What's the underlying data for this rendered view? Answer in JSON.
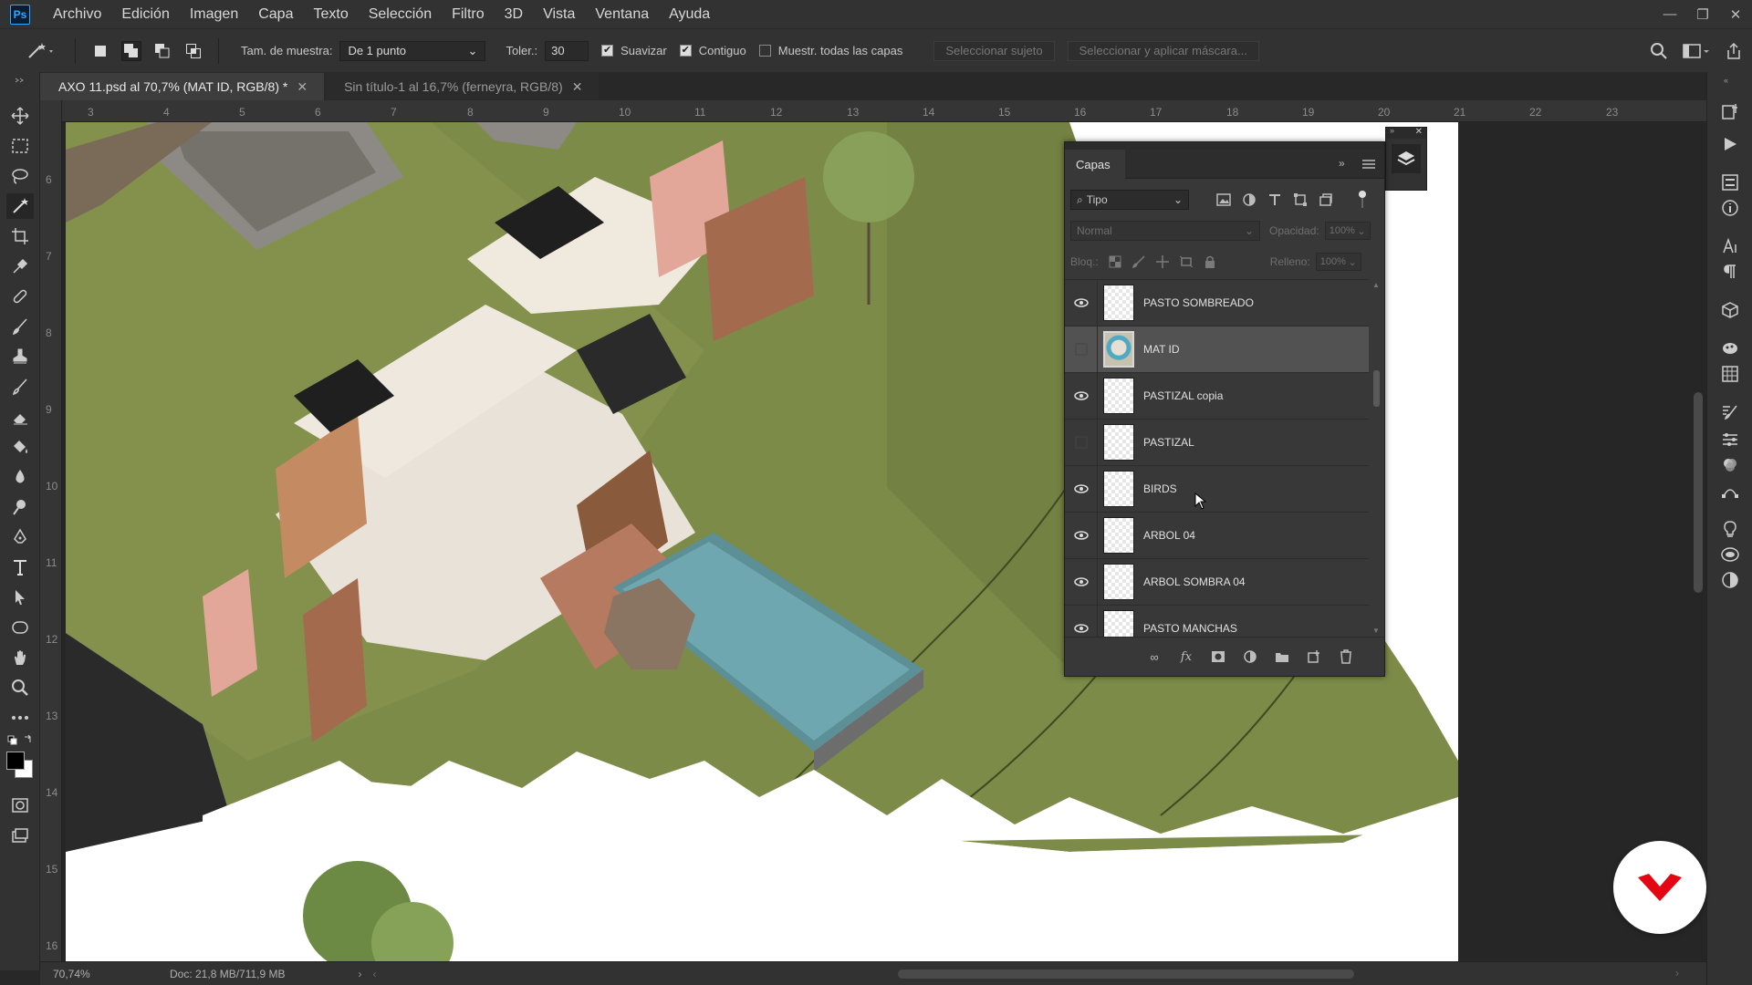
{
  "app": {
    "logo_text": "Ps",
    "menu": [
      "Archivo",
      "Edición",
      "Imagen",
      "Capa",
      "Texto",
      "Selección",
      "Filtro",
      "3D",
      "Vista",
      "Ventana",
      "Ayuda"
    ]
  },
  "options": {
    "sample_size_label": "Tam. de muestra:",
    "sample_size_value": "De 1 punto",
    "tolerance_label": "Toler.:",
    "tolerance_value": "30",
    "antialias_label": "Suavizar",
    "antialias_checked": true,
    "contiguous_label": "Contiguo",
    "contiguous_checked": true,
    "all_layers_label": "Muestr. todas las capas",
    "all_layers_checked": false,
    "select_subject_label": "Seleccionar sujeto",
    "select_mask_label": "Seleccionar y aplicar máscara..."
  },
  "tabs": [
    {
      "label": "AXO 11.psd al 70,7% (MAT ID, RGB/8) *",
      "active": true
    },
    {
      "label": "Sin título-1 al 16,7% (ferneyra, RGB/8)",
      "active": false
    }
  ],
  "rulers": {
    "horizontal": [
      "3",
      "4",
      "5",
      "6",
      "7",
      "8",
      "9",
      "10",
      "11",
      "12",
      "13",
      "14",
      "15",
      "16",
      "17",
      "18",
      "19",
      "20",
      "21",
      "22",
      "23"
    ],
    "vertical": [
      "6",
      "7",
      "8",
      "9",
      "10",
      "11",
      "12",
      "13",
      "14",
      "15",
      "16"
    ]
  },
  "layers_panel": {
    "tab_label": "Capas",
    "filter_label": "Tipo",
    "blend_mode": "Normal",
    "opacity_label": "Opacidad:",
    "opacity_value": "100%",
    "lock_label": "Bloq.:",
    "fill_label": "Relleno:",
    "fill_value": "100%",
    "layers": [
      {
        "name": "PASTO SOMBREADO",
        "visible": true,
        "selected": false
      },
      {
        "name": "MAT ID",
        "visible": false,
        "selected": true
      },
      {
        "name": "PASTIZAL copia",
        "visible": true,
        "selected": false
      },
      {
        "name": "PASTIZAL",
        "visible": false,
        "selected": false
      },
      {
        "name": "BIRDS",
        "visible": true,
        "selected": false
      },
      {
        "name": "ARBOL 04",
        "visible": true,
        "selected": false
      },
      {
        "name": "ARBOL SOMBRA 04",
        "visible": true,
        "selected": false
      },
      {
        "name": "PASTO MANCHAS",
        "visible": true,
        "selected": false
      }
    ]
  },
  "status": {
    "zoom": "70,74%",
    "doc_size": "Doc: 21,8 MB/711,9 MB"
  },
  "colors": {
    "foreground": "#000000",
    "background": "#ffffff",
    "badge_accent": "#e30613"
  }
}
